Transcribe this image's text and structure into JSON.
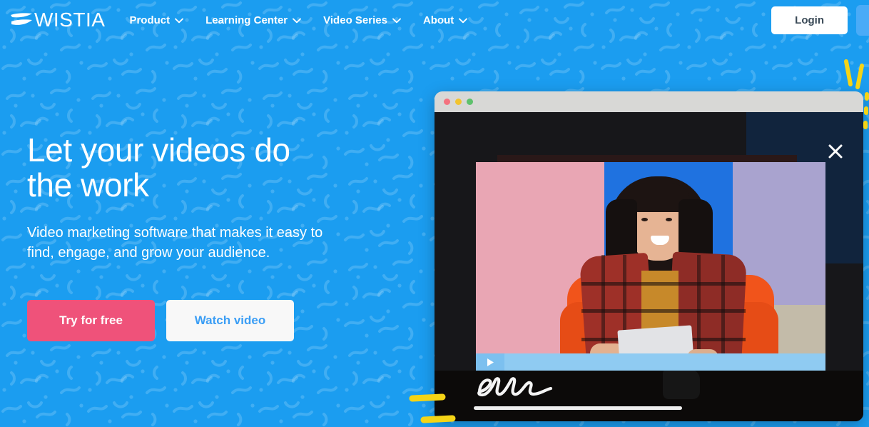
{
  "brand": {
    "name": "WISTIA",
    "logo_icon": "wistia-wave-logo",
    "bg_color": "#1b9df0",
    "accent_pink": "#ef527a",
    "accent_blue_text": "#3b9ef5",
    "accent_yellow": "#f5d416"
  },
  "nav": {
    "items": [
      {
        "label": "Product",
        "icon": "chevron-down-icon"
      },
      {
        "label": "Learning Center",
        "icon": "chevron-down-icon"
      },
      {
        "label": "Video Series",
        "icon": "chevron-down-icon"
      },
      {
        "label": "About",
        "icon": "chevron-down-icon"
      }
    ],
    "login_label": "Login",
    "signup_label": ""
  },
  "hero": {
    "headline": "Let your videos do\nthe work",
    "subheadline": "Video marketing software that makes it easy to\nfind, engage, and grow your audience.",
    "cta_primary": "Try for free",
    "cta_secondary": "Watch video"
  },
  "browser": {
    "traffic_lights": [
      {
        "name": "close",
        "color": "#f4727f"
      },
      {
        "name": "minimize",
        "color": "#f2c42f"
      },
      {
        "name": "maximize",
        "color": "#5ec16c"
      }
    ],
    "close_icon": "close-x-icon",
    "video": {
      "play_icon": "play-triangle-icon",
      "signature": "ellen",
      "scene_description": "woman in red plaid shirt seated in orange chair"
    }
  }
}
